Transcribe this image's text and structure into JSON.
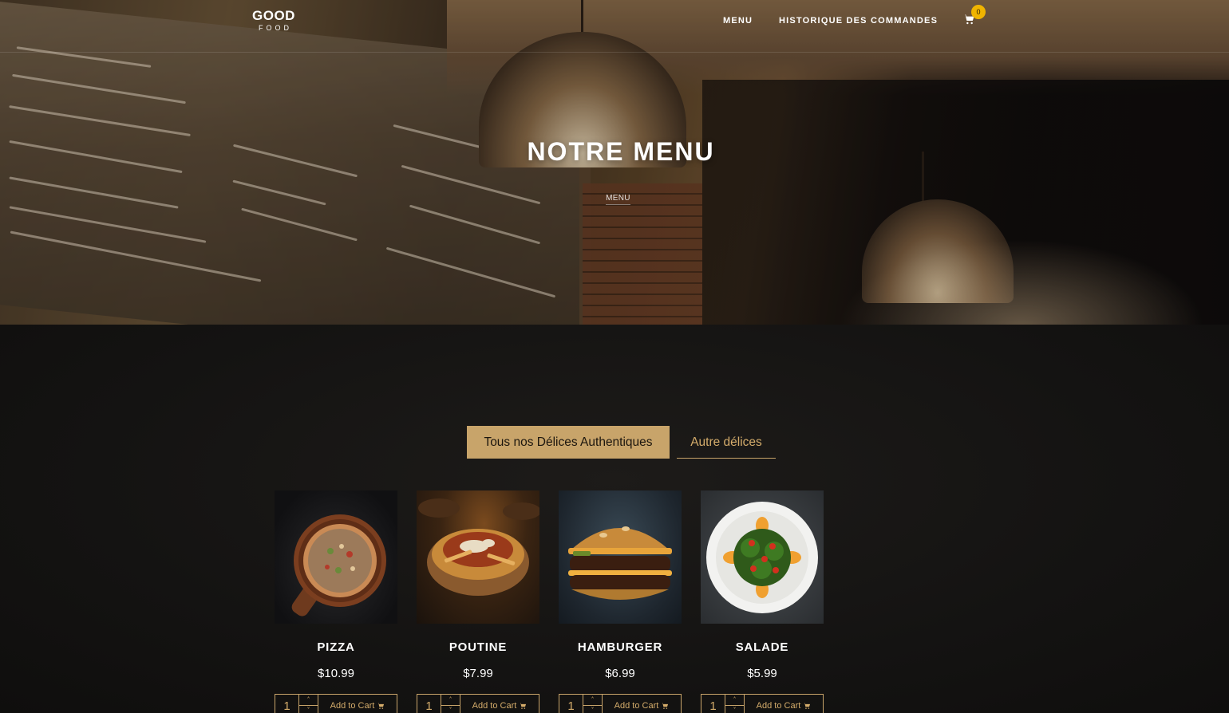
{
  "header": {
    "logo_main": "GOOD",
    "logo_sub": "FOOD",
    "nav": [
      {
        "label": "MENU"
      },
      {
        "label": "HISTORIQUE DES COMMANDES"
      }
    ],
    "cart_count": "0"
  },
  "hero": {
    "title": "NOTRE MENU",
    "breadcrumb": "MENU"
  },
  "tabs": [
    {
      "label": "Tous nos Délices Authentiques",
      "active": true
    },
    {
      "label": "Autre délices",
      "active": false
    }
  ],
  "products": [
    {
      "name": "PIZZA",
      "price": "$10.99",
      "qty": "1",
      "add_label": "Add to Cart",
      "image": "pizza-image"
    },
    {
      "name": "POUTINE",
      "price": "$7.99",
      "qty": "1",
      "add_label": "Add to Cart",
      "image": "poutine-image"
    },
    {
      "name": "HAMBURGER",
      "price": "$6.99",
      "qty": "1",
      "add_label": "Add to Cart",
      "image": "hamburger-image"
    },
    {
      "name": "SALADE",
      "price": "$5.99",
      "qty": "1",
      "add_label": "Add to Cart",
      "image": "salad-image"
    }
  ],
  "colors": {
    "accent": "#c8a46a",
    "accent_text": "#d4ac6b",
    "badge": "#f0b400",
    "background": "#141312"
  },
  "icons": {
    "cart": "shopping-cart-icon",
    "qty_up": "chevron-up-icon",
    "qty_down": "chevron-down-icon"
  }
}
